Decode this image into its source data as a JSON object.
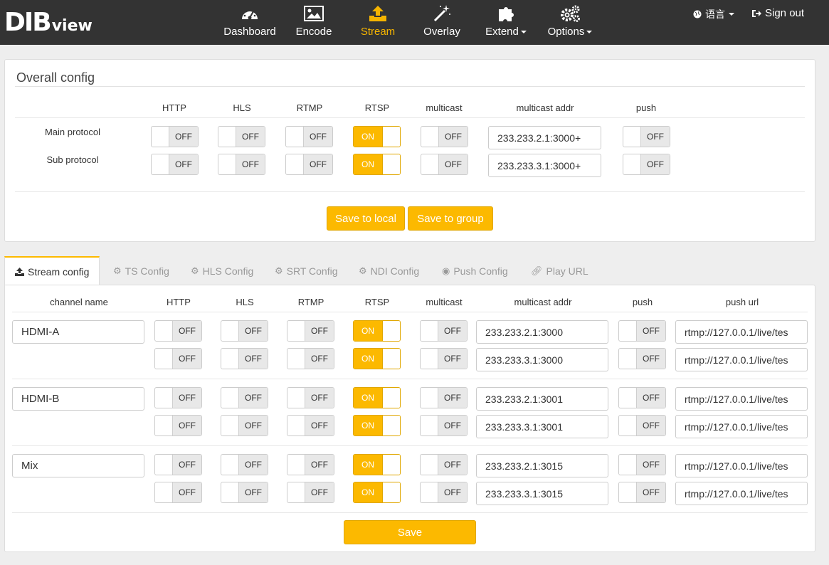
{
  "logo": {
    "big": "DIB",
    "small": "view"
  },
  "nav": [
    {
      "label": "Dashboard",
      "icon": "dashboard-gauge-icon"
    },
    {
      "label": "Encode",
      "icon": "picture-icon"
    },
    {
      "label": "Stream",
      "icon": "upload-icon"
    },
    {
      "label": "Overlay",
      "icon": "magic-wand-icon"
    },
    {
      "label": "Extend",
      "icon": "puzzle-icon"
    },
    {
      "label": "Options",
      "icon": "gears-icon"
    }
  ],
  "active_nav": "Stream",
  "language": "语言",
  "signout": "Sign out",
  "overall": {
    "title": "Overall config",
    "columns": [
      "HTTP",
      "HLS",
      "RTMP",
      "RTSP",
      "multicast",
      "multicast addr",
      "push"
    ],
    "rows": [
      {
        "label": "Main protocol",
        "http": "OFF",
        "hls": "OFF",
        "rtmp": "OFF",
        "rtsp": "ON",
        "multicast": "OFF",
        "addr": "233.233.2.1:3000+",
        "push": "OFF"
      },
      {
        "label": "Sub protocol",
        "http": "OFF",
        "hls": "OFF",
        "rtmp": "OFF",
        "rtsp": "ON",
        "multicast": "OFF",
        "addr": "233.233.3.1:3000+",
        "push": "OFF"
      }
    ],
    "save_local": "Save to local",
    "save_group": "Save to group"
  },
  "tabs": [
    "Stream config",
    "TS Config",
    "HLS Config",
    "SRT Config",
    "NDI Config",
    "Push Config",
    "Play URL"
  ],
  "stream": {
    "columns": [
      "channel name",
      "HTTP",
      "HLS",
      "RTMP",
      "RTSP",
      "multicast",
      "multicast addr",
      "push",
      "push url"
    ],
    "channels": [
      {
        "name": "HDMI-A",
        "rows": [
          {
            "http": "OFF",
            "hls": "OFF",
            "rtmp": "OFF",
            "rtsp": "ON",
            "multicast": "OFF",
            "addr": "233.233.2.1:3000",
            "push": "OFF",
            "url": "rtmp://127.0.0.1/live/tes"
          },
          {
            "http": "OFF",
            "hls": "OFF",
            "rtmp": "OFF",
            "rtsp": "ON",
            "multicast": "OFF",
            "addr": "233.233.3.1:3000",
            "push": "OFF",
            "url": "rtmp://127.0.0.1/live/tes"
          }
        ]
      },
      {
        "name": "HDMI-B",
        "rows": [
          {
            "http": "OFF",
            "hls": "OFF",
            "rtmp": "OFF",
            "rtsp": "ON",
            "multicast": "OFF",
            "addr": "233.233.2.1:3001",
            "push": "OFF",
            "url": "rtmp://127.0.0.1/live/tes"
          },
          {
            "http": "OFF",
            "hls": "OFF",
            "rtmp": "OFF",
            "rtsp": "ON",
            "multicast": "OFF",
            "addr": "233.233.3.1:3001",
            "push": "OFF",
            "url": "rtmp://127.0.0.1/live/tes"
          }
        ]
      },
      {
        "name": "Mix",
        "rows": [
          {
            "http": "OFF",
            "hls": "OFF",
            "rtmp": "OFF",
            "rtsp": "ON",
            "multicast": "OFF",
            "addr": "233.233.2.1:3015",
            "push": "OFF",
            "url": "rtmp://127.0.0.1/live/tes"
          },
          {
            "http": "OFF",
            "hls": "OFF",
            "rtmp": "OFF",
            "rtsp": "ON",
            "multicast": "OFF",
            "addr": "233.233.3.1:3015",
            "push": "OFF",
            "url": "rtmp://127.0.0.1/live/tes"
          }
        ]
      }
    ],
    "save": "Save"
  },
  "colors": {
    "accent": "#fcb900",
    "topbar": "#333333"
  }
}
